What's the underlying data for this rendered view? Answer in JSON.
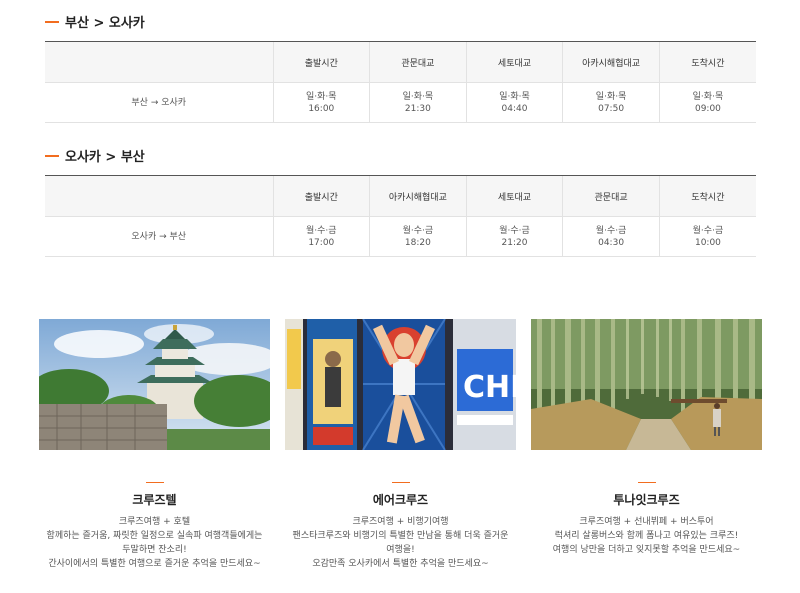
{
  "section1": {
    "title": "부산 > 오사카",
    "headers": [
      "",
      "출발시간",
      "관문대교",
      "세토대교",
      "아카시해협대교",
      "도착시간"
    ],
    "row": {
      "route": "부산 → 오사카",
      "cells": [
        {
          "days": "일·화·목",
          "time": "16:00"
        },
        {
          "days": "일·화·목",
          "time": "21:30"
        },
        {
          "days": "일·화·목",
          "time": "04:40"
        },
        {
          "days": "일·화·목",
          "time": "07:50"
        },
        {
          "days": "일·화·목",
          "time": "09:00"
        }
      ]
    }
  },
  "section2": {
    "title": "오사카 > 부산",
    "headers": [
      "",
      "출발시간",
      "아카시해협대교",
      "세토대교",
      "관문대교",
      "도착시간"
    ],
    "row": {
      "route": "오사카 → 부산",
      "cells": [
        {
          "days": "월·수·금",
          "time": "17:00"
        },
        {
          "days": "월·수·금",
          "time": "18:20"
        },
        {
          "days": "월·수·금",
          "time": "21:20"
        },
        {
          "days": "월·수·금",
          "time": "04:30"
        },
        {
          "days": "월·수·금",
          "time": "10:00"
        }
      ]
    }
  },
  "cards": [
    {
      "title": "크루즈텔",
      "lines": [
        "크루즈여행 + 호텔",
        "함께하는 즐거움, 짜릿한 일정으로 실속파 여행객들에게는",
        "두말하면 잔소리!",
        "간사이에서의 특별한 여행으로 즐거운 추억을 만드세요~"
      ]
    },
    {
      "title": "에어크루즈",
      "lines": [
        "크루즈여행 + 비행기여행",
        "팬스타크루즈와 비행기의 특별한 만남을 통해 더욱 즐거운",
        "여행을!",
        "오감만족 오사카에서 특별한 추억을 만드세요~"
      ]
    },
    {
      "title": "투나잇크루즈",
      "lines": [
        "크루즈여행 + 선내뷔페 + 버스투어",
        "럭셔리 살롱버스와 함께 폼나고 여유있는 크루즈!",
        "여행의 낭만을 더하고 잊지못할 추억을 만드세요~"
      ]
    }
  ],
  "colors": {
    "accent": "#f26d1f",
    "header_bg": "#f6f6f6"
  }
}
